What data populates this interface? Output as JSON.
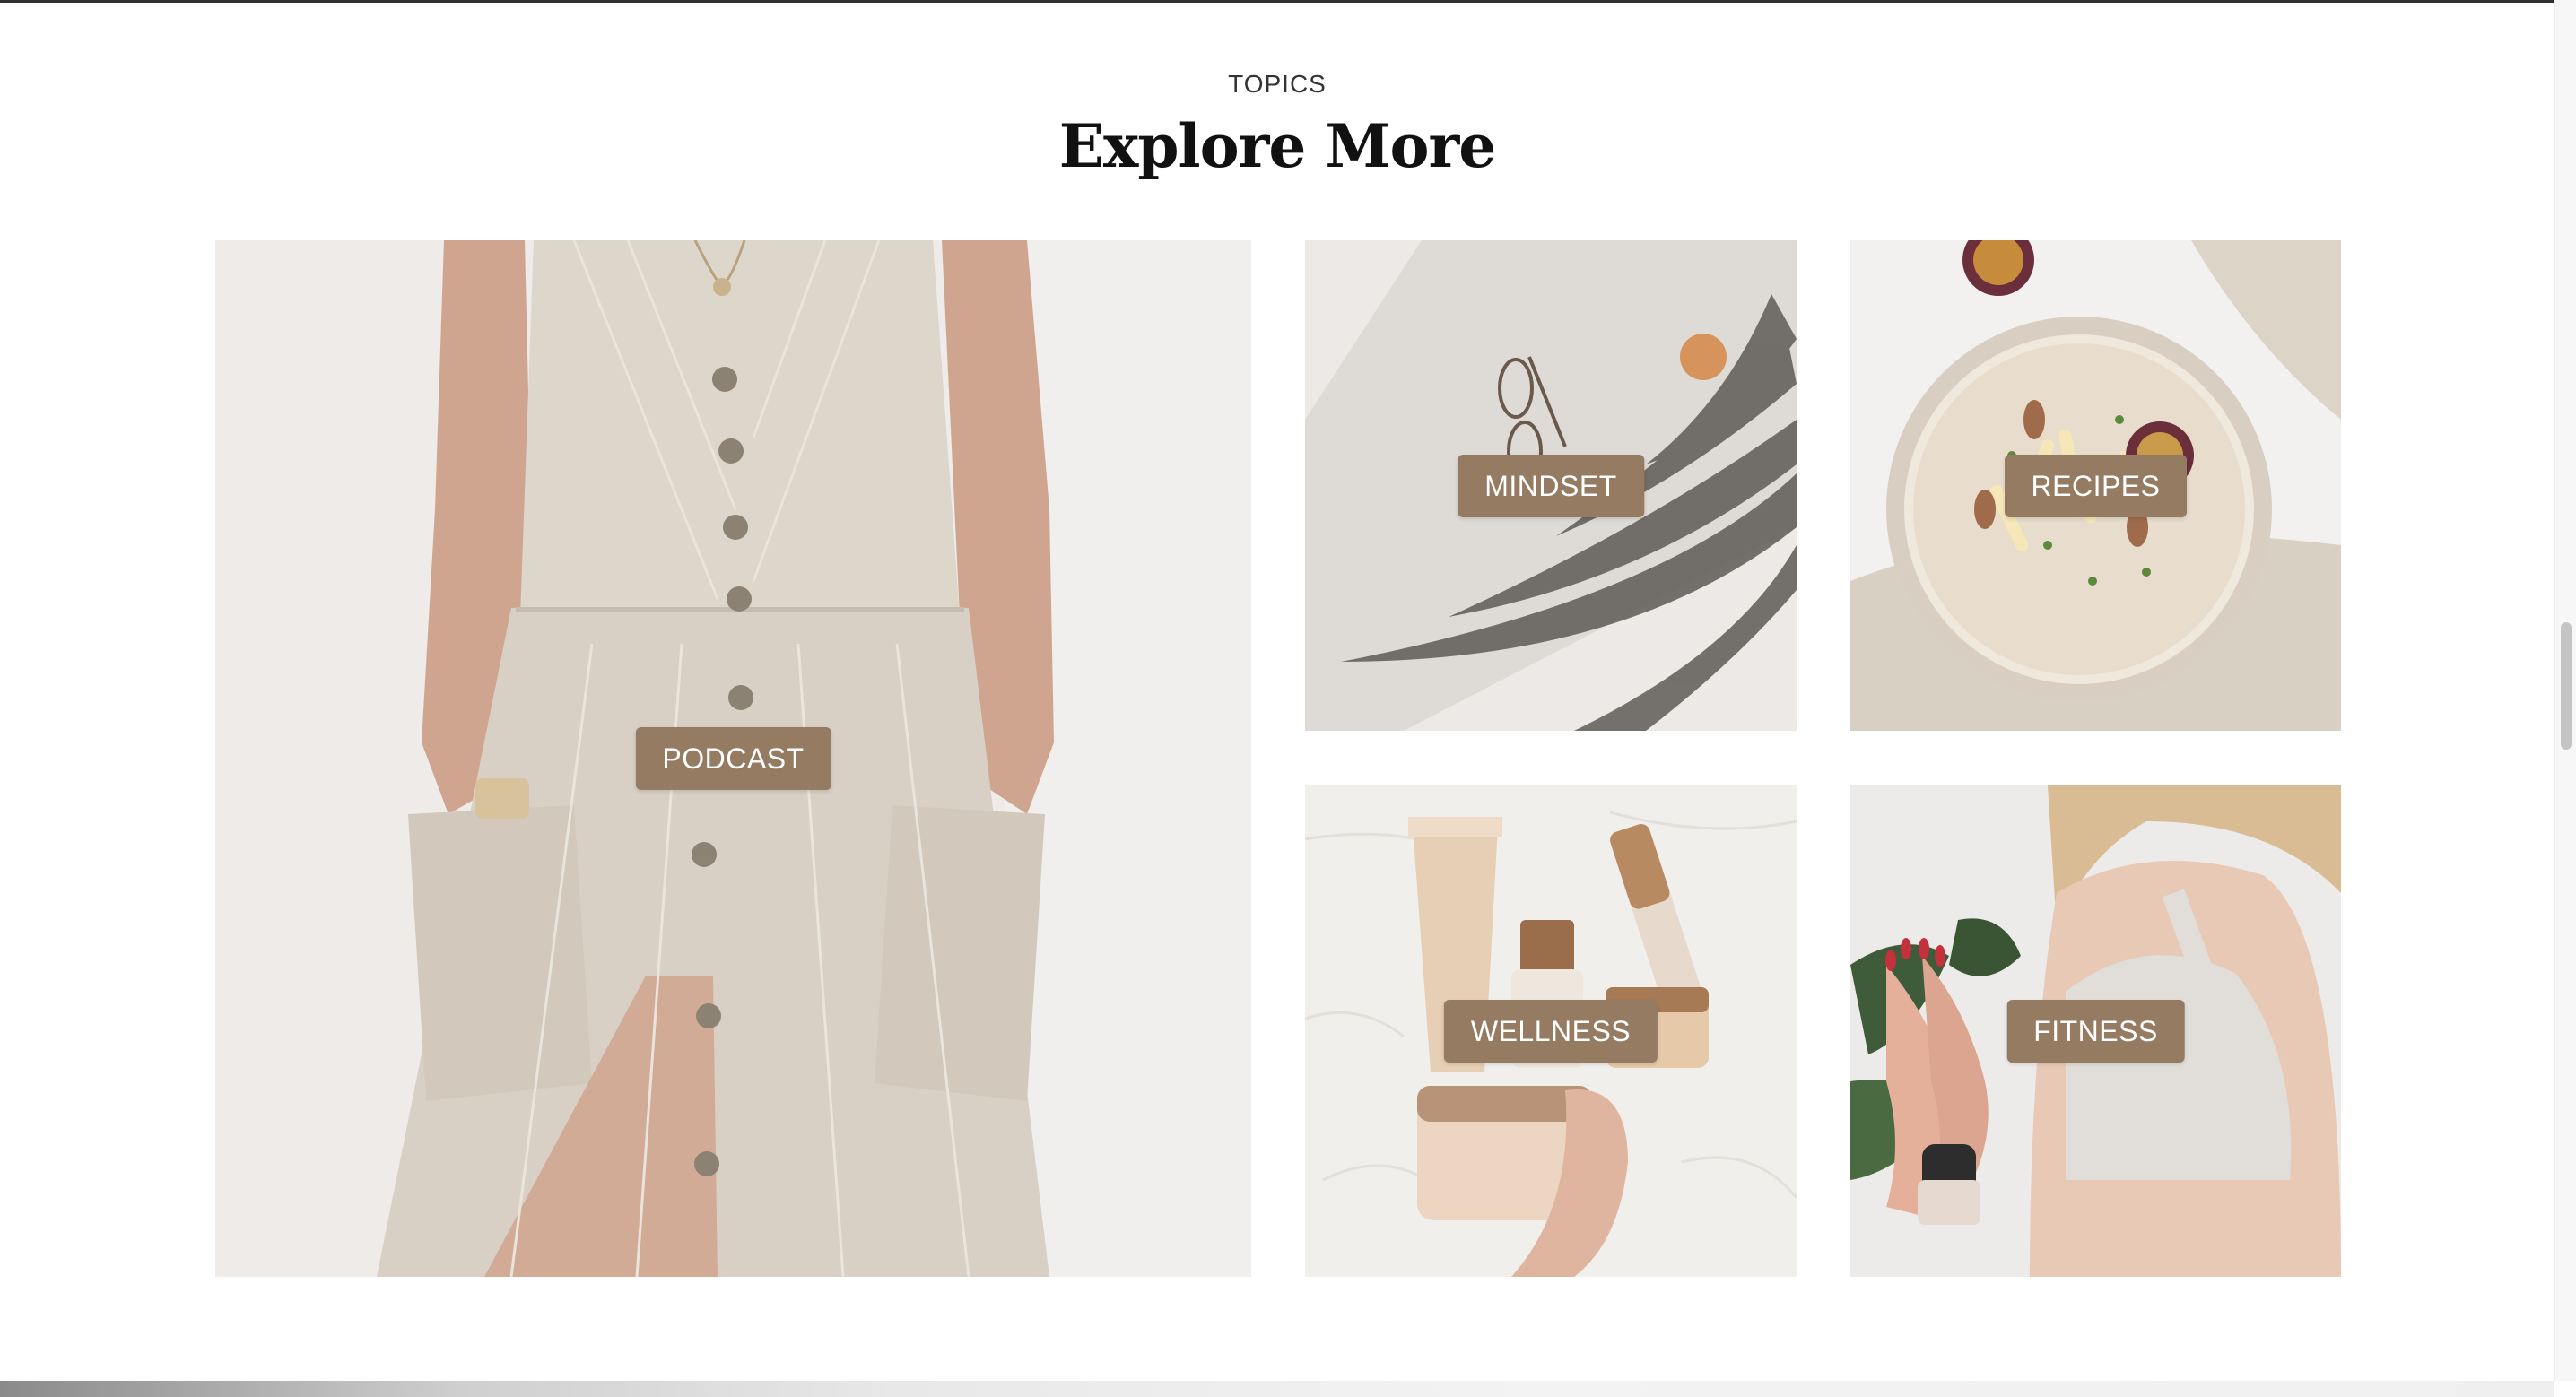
{
  "section": {
    "eyebrow": "TOPICS",
    "title": "Explore More"
  },
  "topics": [
    {
      "label": "PODCAST"
    },
    {
      "label": "MINDSET"
    },
    {
      "label": "RECIPES"
    },
    {
      "label": "WELLNESS"
    },
    {
      "label": "FITNESS"
    }
  ],
  "colors": {
    "label_background": "#957b62",
    "label_text": "#ffffff",
    "heading": "#111111"
  }
}
